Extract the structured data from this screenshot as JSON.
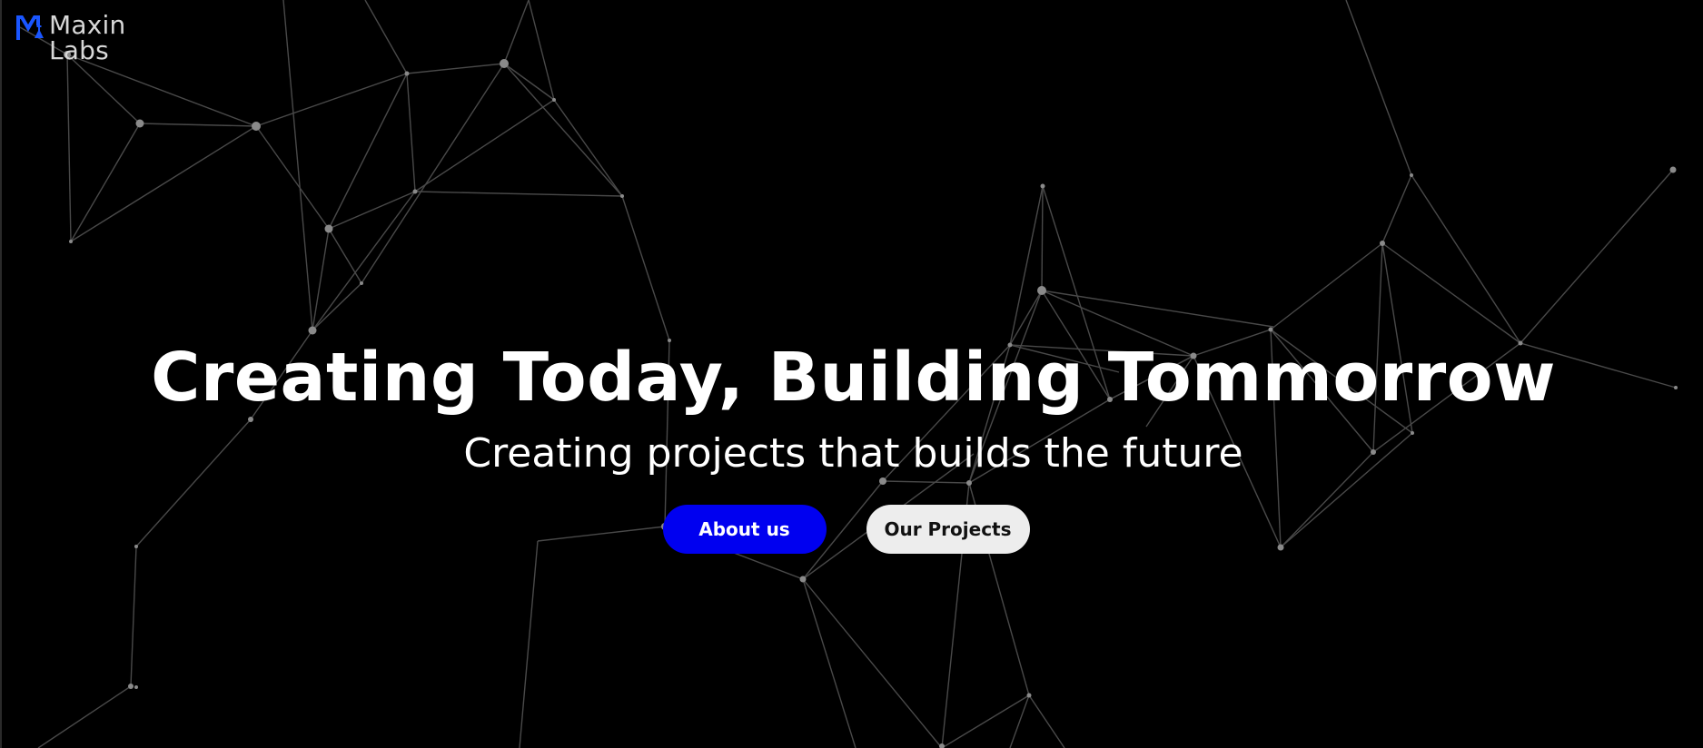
{
  "brand": {
    "name_line1": "Maxin",
    "name_line2": "Labs",
    "mark_icon": "m-flask-logo-icon",
    "mark_color": "#1a56ff"
  },
  "hero": {
    "headline": "Creating Today, Building Tommorrow",
    "subheadline": "Creating projects that builds the future"
  },
  "actions": {
    "about_label": "About us",
    "projects_label": "Our Projects"
  },
  "colors": {
    "background": "#000000",
    "primary_button": "#0000f0",
    "secondary_button": "#ededed",
    "network_lines": "#5a5a5a"
  },
  "background_visual": "network-particles-icon"
}
